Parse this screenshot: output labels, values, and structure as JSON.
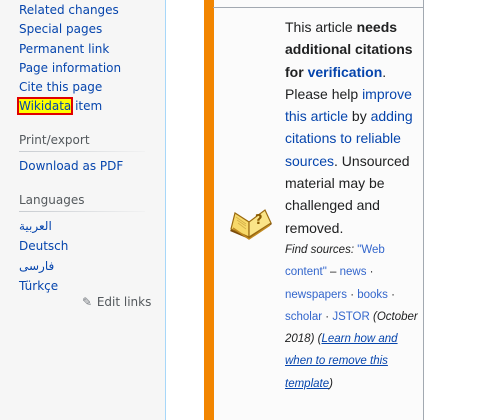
{
  "sidebar": {
    "tools": [
      {
        "label": "Related changes"
      },
      {
        "label": "Special pages"
      },
      {
        "label": "Permanent link"
      },
      {
        "label": "Page information"
      },
      {
        "label": "Cite this page"
      }
    ],
    "wikidata": {
      "highlight": "Wikidata",
      "rest": " item"
    },
    "print_export": {
      "heading": "Print/export",
      "items": [
        {
          "label": "Download as PDF"
        }
      ]
    },
    "languages": {
      "heading": "Languages",
      "items": [
        {
          "label": "العربية"
        },
        {
          "label": "Deutsch"
        },
        {
          "label": "فارسی"
        },
        {
          "label": "Türkçe"
        }
      ],
      "edit_links": "Edit links"
    }
  },
  "ambox": {
    "icon": "question-book-icon",
    "text_1": "This article ",
    "bold_1": "needs additional citations for",
    "link_verification": "verification",
    "text_2": ". Please help ",
    "link_improve": "improve this article",
    "text_3": " by ",
    "link_adding": "adding citations to reliable sources",
    "text_4": ". Unsourced material may be challenged and removed.",
    "find_sources_label": "Find sources:",
    "source_web": "\"Web content\"",
    "dash": " – ",
    "source_news": "news",
    "sep": " · ",
    "source_newspapers": "newspapers",
    "source_books": "books",
    "source_scholar": "scholar",
    "source_jstor": "JSTOR",
    "date_text": "(October 2018)",
    "learn_link": "Learn how and when to remove this template"
  },
  "colors": {
    "link": "#0645ad",
    "accent_orange": "#f28500",
    "highlight_yellow": "#ffff00",
    "highlight_border": "#e00000"
  }
}
